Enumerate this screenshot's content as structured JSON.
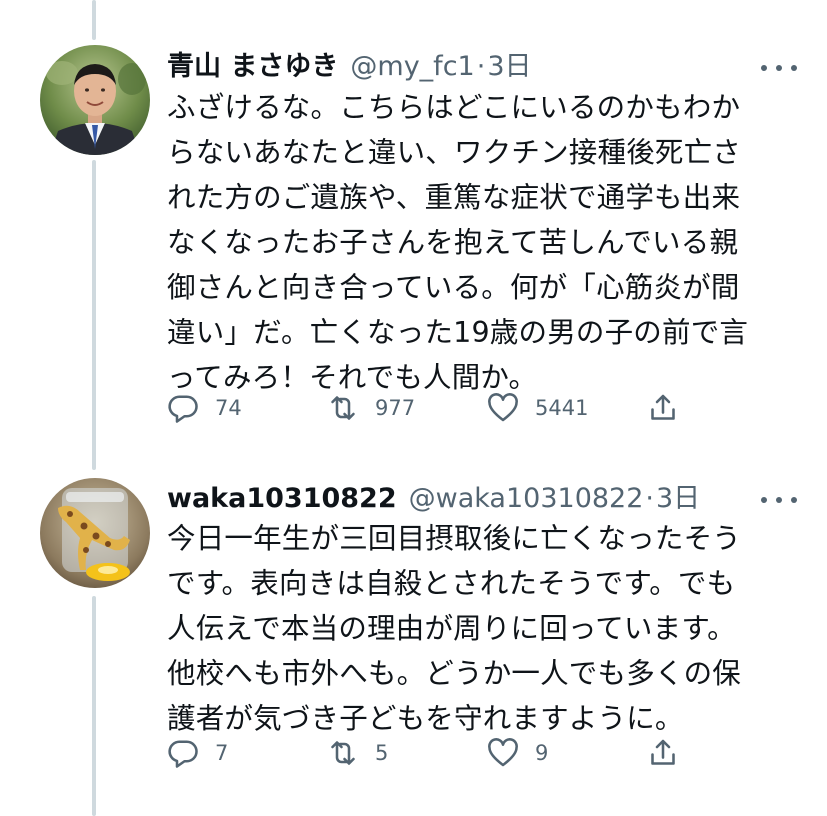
{
  "tweets": [
    {
      "name": "青山 まさゆき",
      "handle": "@my_fc1",
      "separator": "·",
      "time": "3日",
      "lines": [
        "ふざけるな。こちらはどこにいるのかもわか",
        "らないあなたと違い、ワクチン接種後死亡さ",
        "れた方のご遺族や、重篤な症状で通学も出来",
        "なくなったお子さんを抱えて苦しんでいる親",
        "御さんと向き合っている。何が「心筋炎が間",
        "違い」だ。亡くなった19歳の男の子の前で言",
        "ってみろ！それでも人間か。"
      ],
      "replies": "74",
      "retweets": "977",
      "likes": "5441"
    },
    {
      "name": "waka10310822",
      "handle": "@waka10310822",
      "separator": "·",
      "time": "3日",
      "lines": [
        "今日一年生が三回目摂取後に亡くなったそう",
        "です。表向きは自殺とされたそうです。でも",
        "人伝えで本当の理由が周りに回っています。",
        "他校へも市外へも。どうか一人でも多くの保",
        "護者が気づき子どもを守れますように。"
      ],
      "replies": "7",
      "retweets": "5",
      "likes": "9"
    }
  ],
  "icons": {
    "reply": "reply-icon",
    "retweet": "retweet-icon",
    "like": "heart-icon",
    "share": "share-icon",
    "more": "more-icon"
  },
  "colors": {
    "text": "#0f1419",
    "muted": "#536471",
    "thread_line": "#cfd9de"
  }
}
